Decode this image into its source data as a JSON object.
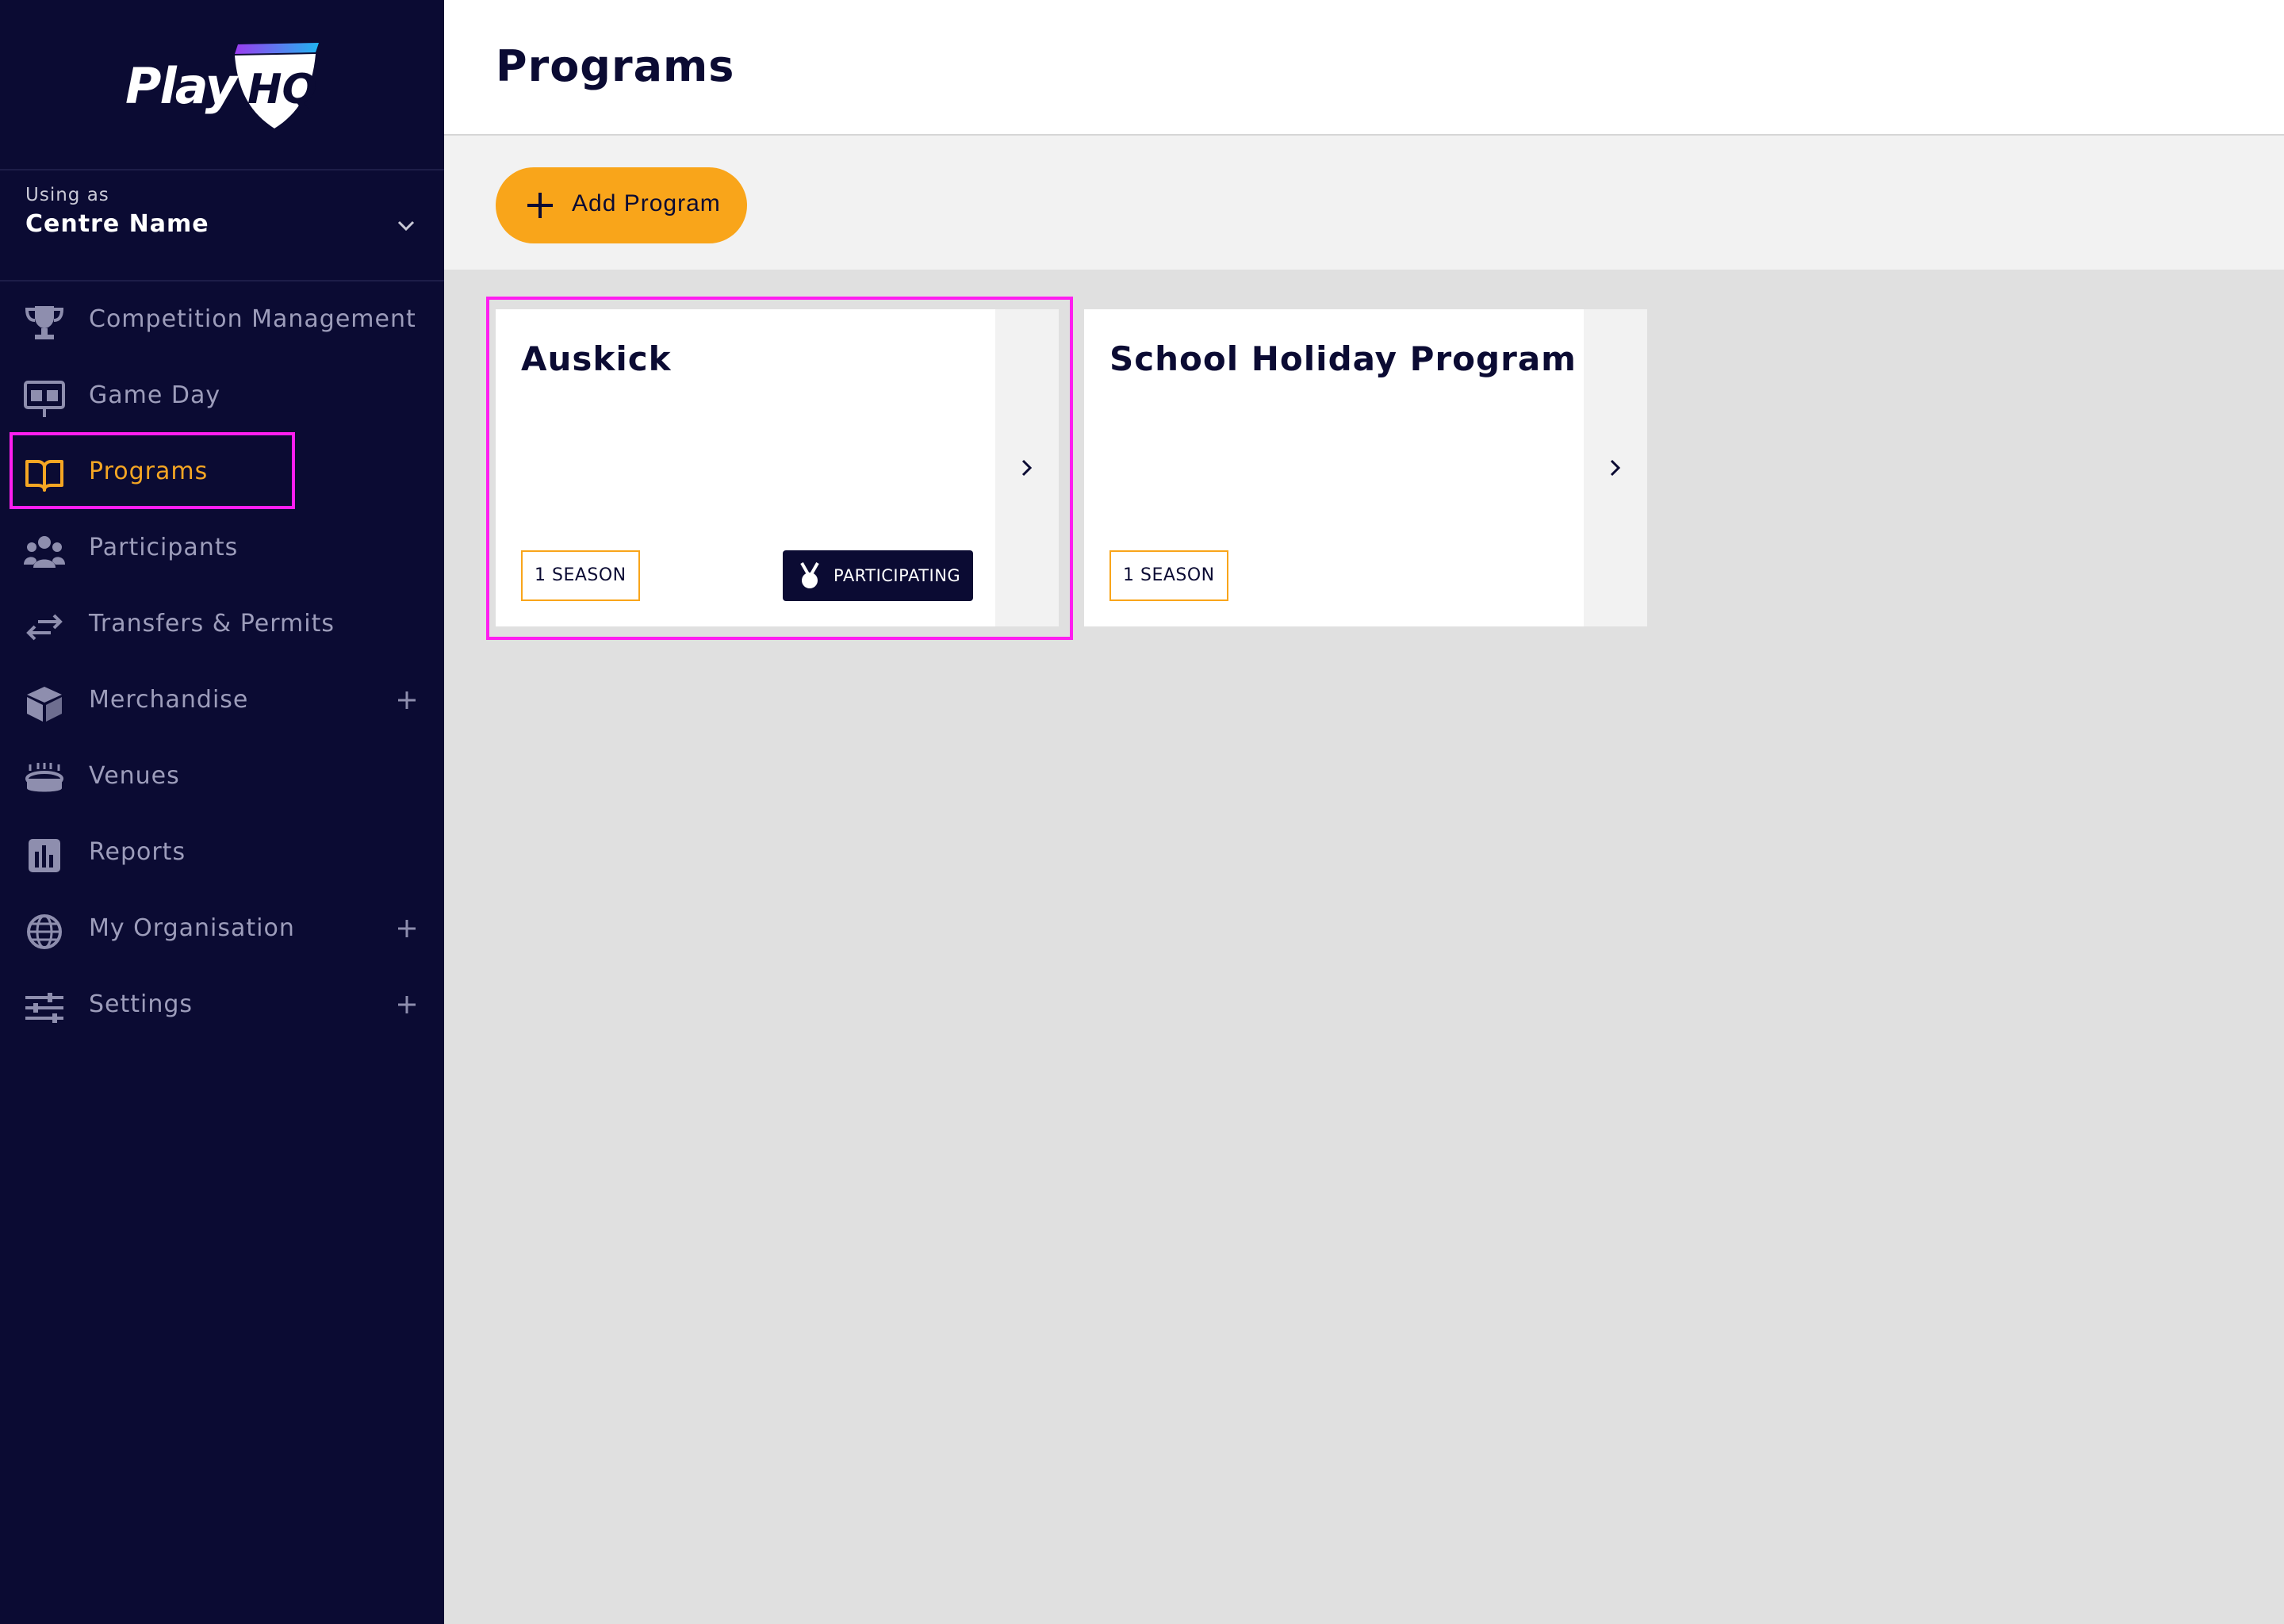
{
  "brand": {
    "logo_text": "Play",
    "logo_badge_text": "HQ",
    "accent": "#f9a51a",
    "sidebar_bg": "#0b0b33",
    "highlight": "#ff1ef0"
  },
  "using_as": {
    "label": "Using as",
    "name": "Centre Name"
  },
  "nav": [
    {
      "label": "Competition Management",
      "icon": "trophy-icon"
    },
    {
      "label": "Game Day",
      "icon": "scoreboard-icon"
    },
    {
      "label": "Programs",
      "icon": "book-icon",
      "active": true
    },
    {
      "label": "Participants",
      "icon": "people-icon"
    },
    {
      "label": "Transfers & Permits",
      "icon": "transfer-arrows-icon"
    },
    {
      "label": "Merchandise",
      "icon": "box-icon",
      "expandable": true
    },
    {
      "label": "Venues",
      "icon": "stadium-icon"
    },
    {
      "label": "Reports",
      "icon": "bar-chart-icon"
    },
    {
      "label": "My Organisation",
      "icon": "globe-icon",
      "expandable": true
    },
    {
      "label": "Settings",
      "icon": "sliders-icon",
      "expandable": true
    }
  ],
  "page": {
    "title": "Programs"
  },
  "toolbar": {
    "add_label": "Add Program"
  },
  "programs": [
    {
      "title": "Auskick",
      "seasons": "1 SEASON",
      "status": "PARTICIPATING"
    },
    {
      "title": "School Holiday Program",
      "seasons": "1 SEASON"
    }
  ]
}
